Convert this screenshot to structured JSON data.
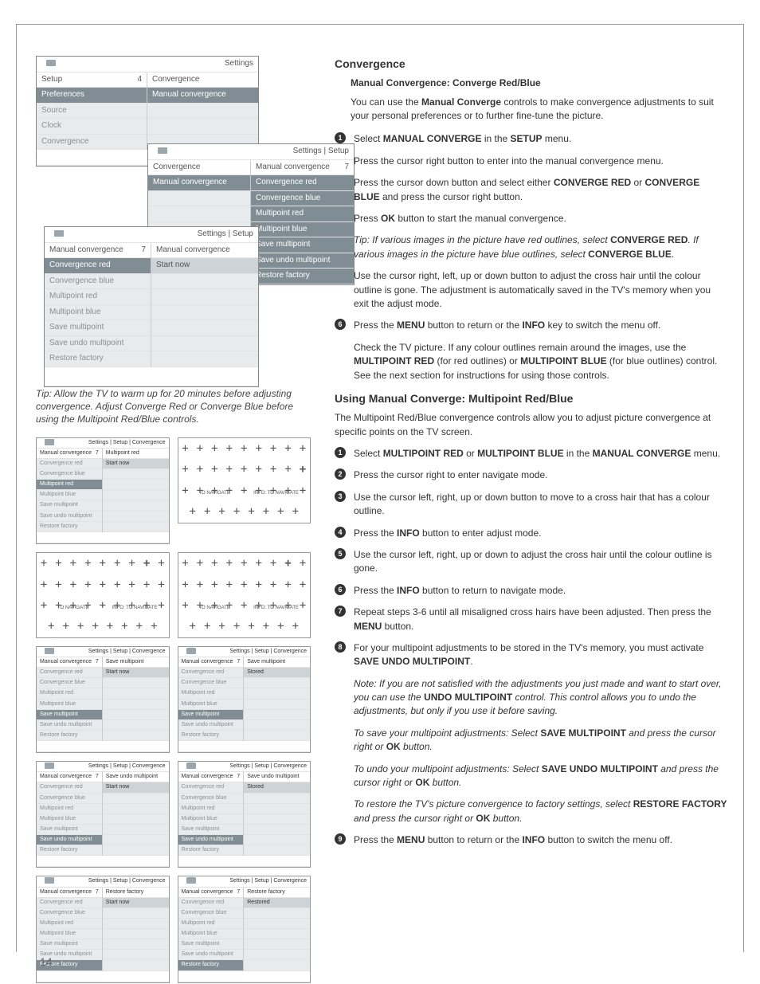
{
  "page_number": "14",
  "left": {
    "menu1": {
      "tab": "Settings",
      "header_left": "Setup",
      "header_num": "4",
      "header_right": "Convergence",
      "left_items": [
        "Preferences",
        "Source",
        "Clock",
        "Convergence"
      ],
      "right_hl": "Manual convergence"
    },
    "menu2": {
      "tab": "Settings | Setup",
      "header_left": "Convergence",
      "header_right": "Manual convergence",
      "header_num": "7",
      "left_hl": "Manual convergence",
      "right_items": [
        "Convergence red",
        "Convergence blue",
        "Multipoint red",
        "Multipoint blue",
        "Save multipoint",
        "Save undo multipoint",
        "Restore factory"
      ]
    },
    "menu3": {
      "tab": "Settings | Setup",
      "header_left": "Manual convergence",
      "header_num": "7",
      "header_right": "Manual convergence",
      "left_items": [
        "Convergence red",
        "Convergence blue",
        "Multipoint red",
        "Multipoint blue",
        "Save multipoint",
        "Save undo multipoint",
        "Restore factory"
      ],
      "right_btn": "Start now"
    },
    "tip": "Tip: Allow the TV to warm up for 20 minutes before adjusting convergence. Adjust Converge Red or Converge Blue before using the Multipoint Red/Blue controls.",
    "mini_header_path": "Settings | Setup | Convergence",
    "mini_header_left": "Manual convergence",
    "mini_header_num": "7",
    "mini_items": [
      "Convergence red",
      "Convergence blue",
      "Multipoint red",
      "Multipoint blue",
      "Save multipoint",
      "Save undo multipoint",
      "Restore factory"
    ],
    "mini_btn_start": "Start now",
    "mini_titles": {
      "multipoint_red": "Multipoint red",
      "save_multipoint": "Save multipoint",
      "save_undo": "Save undo multipoint",
      "restore": "Restore factory",
      "stored": "Stored",
      "restored": "Restored"
    },
    "crosshair_labels": {
      "nav": "TO NAVIGATE",
      "info": "INFO: TO NAVIGATE"
    }
  },
  "right": {
    "h_conv": "Convergence",
    "h_manual": "Manual Convergence: Converge Red/Blue",
    "intro1a": "You can use the ",
    "intro1b": "Manual Converge",
    "intro1c": " controls to make convergence adjustments to suit your personal preferences or to further fine-tune the picture.",
    "s1a": "Select ",
    "s1b": "MANUAL CONVERGE",
    "s1c": " in the ",
    "s1d": "SETUP",
    "s1e": " menu.",
    "s2": "Press the cursor right button to enter into the manual convergence menu.",
    "s3a": "Press the cursor down button and select either ",
    "s3b": "CONVERGE RED",
    "s3c": " or ",
    "s3d": "CONVERGE BLUE",
    "s3e": " and press the cursor right button.",
    "s4a": "Press ",
    "s4b": "OK",
    "s4c": " button to start the manual convergence.",
    "tip2a": "Tip: If various images in the picture have red outlines, select ",
    "tip2b": "CONVERGE RED",
    "tip2c": ". If various images in the picture have blue outlines, select ",
    "tip2d": "CONVERGE BLUE",
    "tip2e": ".",
    "s5": "Use the cursor right, left, up or down button to adjust the cross hair until the colour outline is gone. The adjustment is automatically saved in the TV's memory when you exit the adjust mode.",
    "s6a": "Press the ",
    "s6b": "MENU",
    "s6c": " button to return or the ",
    "s6d": "INFO",
    "s6e": " key to switch the menu off.",
    "check_a": "Check the TV picture. If any colour outlines remain around the images, use the ",
    "check_b": "MULTIPOINT RED",
    "check_c": " (for red outlines) or ",
    "check_d": "MULTIPOINT BLUE",
    "check_e": " (for blue outlines) control. See the next section for instructions for using those controls.",
    "h_multi": "Using Manual Converge: Multipoint Red/Blue",
    "intro2": "The Multipoint Red/Blue convergence controls allow you to adjust picture convergence at specific points on the TV screen.",
    "m1a": "Select ",
    "m1b": "MULTIPOINT RED",
    "m1c": " or ",
    "m1d": "MULTIPOINT BLUE",
    "m1e": " in the ",
    "m1f": "MANUAL CONVERGE",
    "m1g": " menu.",
    "m2": "Press the cursor right to enter navigate mode.",
    "m3": "Use the cursor left, right, up or down button to move to a cross hair that has a colour outline.",
    "m4a": "Press the ",
    "m4b": "INFO",
    "m4c": " button to enter adjust mode.",
    "m5": "Use the cursor left, right, up or down to adjust the cross hair until the colour outline is gone.",
    "m6a": "Press the ",
    "m6b": "INFO",
    "m6c": " button to return to navigate mode.",
    "m7a": "Repeat steps 3-6 until all misaligned cross hairs have been adjusted. Then press the ",
    "m7b": "MENU",
    "m7c": " button.",
    "m8a": "For your multipoint adjustments to be stored in the TV's memory, you must activate ",
    "m8b": "SAVE UNDO MULTIPOINT",
    "m8c": ".",
    "note_a": "Note:  If  you are not satisfied with the adjustments you just made and want to start over, you can use the ",
    "note_b": "UNDO MULTIPOINT",
    "note_c": " control. This control allows you to undo the adjustments, but only if you use it before saving.",
    "save_a": "To save your multipoint adjustments: Select ",
    "save_b": "SAVE MULTIPOINT",
    "save_c": " and press the cursor right or ",
    "save_d": "OK",
    "save_e": " button.",
    "undo_a": "To undo your multipoint adjustments: Select ",
    "undo_b": "SAVE UNDO MULTIPOINT",
    "undo_c": " and press the cursor right or ",
    "undo_d": "OK",
    "undo_e": " button.",
    "rest_a": "To restore the TV's picture convergence to factory settings, select ",
    "rest_b": "RESTORE FACTORY",
    "rest_c": " and press the cursor right or ",
    "rest_d": "OK",
    "rest_e": " button.",
    "m9a": "Press the ",
    "m9b": "MENU",
    "m9c": " button to return or the ",
    "m9d": "INFO",
    "m9e": " button to switch the menu off."
  }
}
